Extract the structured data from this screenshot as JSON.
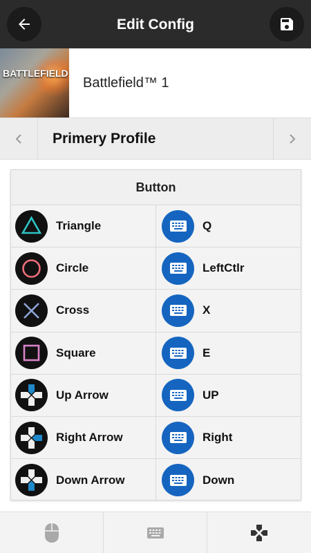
{
  "header": {
    "title": "Edit Config",
    "back_icon": "arrow-left-icon",
    "save_icon": "floppy-disk-icon"
  },
  "game": {
    "cover_text": "BATTLEFIELD 1",
    "name": "Battlefield™ 1"
  },
  "profile": {
    "name": "Primery Profile",
    "prev_icon": "chevron-left-icon",
    "next_icon": "chevron-right-icon"
  },
  "mapping": {
    "header": "Button",
    "rows": [
      {
        "button": "Triangle",
        "key": "Q"
      },
      {
        "button": "Circle",
        "key": "LeftCtlr"
      },
      {
        "button": "Cross",
        "key": "X"
      },
      {
        "button": "Square",
        "key": "E"
      },
      {
        "button": "Up Arrow",
        "key": "UP"
      },
      {
        "button": "Right Arrow",
        "key": "Right"
      },
      {
        "button": "Down Arrow",
        "key": "Down"
      }
    ]
  },
  "bottom_tabs": [
    {
      "icon": "mouse-icon"
    },
    {
      "icon": "keyboard-icon"
    },
    {
      "icon": "gamepad-icon"
    }
  ],
  "colors": {
    "header_bg": "#2b2b2b",
    "keyboard_blue": "#1565c0",
    "triangle": "#2ec4c4",
    "circle": "#ef6f7c",
    "cross": "#8ea6d8",
    "square": "#d884c8",
    "dpad_active": "#1e88c9"
  }
}
